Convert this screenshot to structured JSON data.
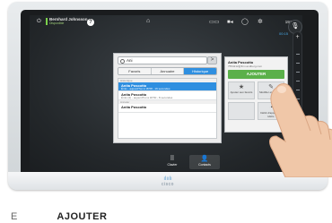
{
  "status_bar": {
    "power_icon": "power-icon",
    "user_name": "Bernhard Johnsson",
    "user_status": "Disponible",
    "help_label": "?",
    "time": "19:54",
    "call_timer": "00:15"
  },
  "search": {
    "query": "Ani",
    "go_label": ">"
  },
  "tabs": [
    {
      "label": "Favoris"
    },
    {
      "label": "Annuaire"
    },
    {
      "label": "Historique"
    }
  ],
  "list": {
    "section_recent": "Historique",
    "section_older": "Annuler",
    "rows": [
      {
        "name": "Anita Poscotto",
        "detail": "Émis - aujourd'hui à 18:58 - 16 secondes"
      },
      {
        "name": "Anita Poscotto",
        "detail": "Émis (2) - aujourd'hui à 18:50 - 8 secondes"
      },
      {
        "name": "Anita Poscotto",
        "detail": ""
      }
    ]
  },
  "contact_card": {
    "name": "Anita Poscotto",
    "address": "7554212@firm.andberg.com",
    "add_label": "AJOUTER",
    "actions": [
      {
        "icon": "star-icon",
        "label": "Ajouter aux favoris"
      },
      {
        "icon": "edit-icon",
        "label": "Modifier et rappeler"
      },
      {
        "icon": "",
        "label": ""
      },
      {
        "icon": "speed-icon",
        "label": "Débit d'appel 768 kbit/s"
      }
    ]
  },
  "dock": {
    "keypad_label": "Clavier",
    "contacts_label": "Contacts"
  },
  "brand": "cisco",
  "caption": {
    "text": "AJOUTER",
    "prefix": "E"
  },
  "colors": {
    "accent": "#2f8fe0",
    "add_green": "#5bb04a",
    "status_green": "#7bd14b"
  }
}
